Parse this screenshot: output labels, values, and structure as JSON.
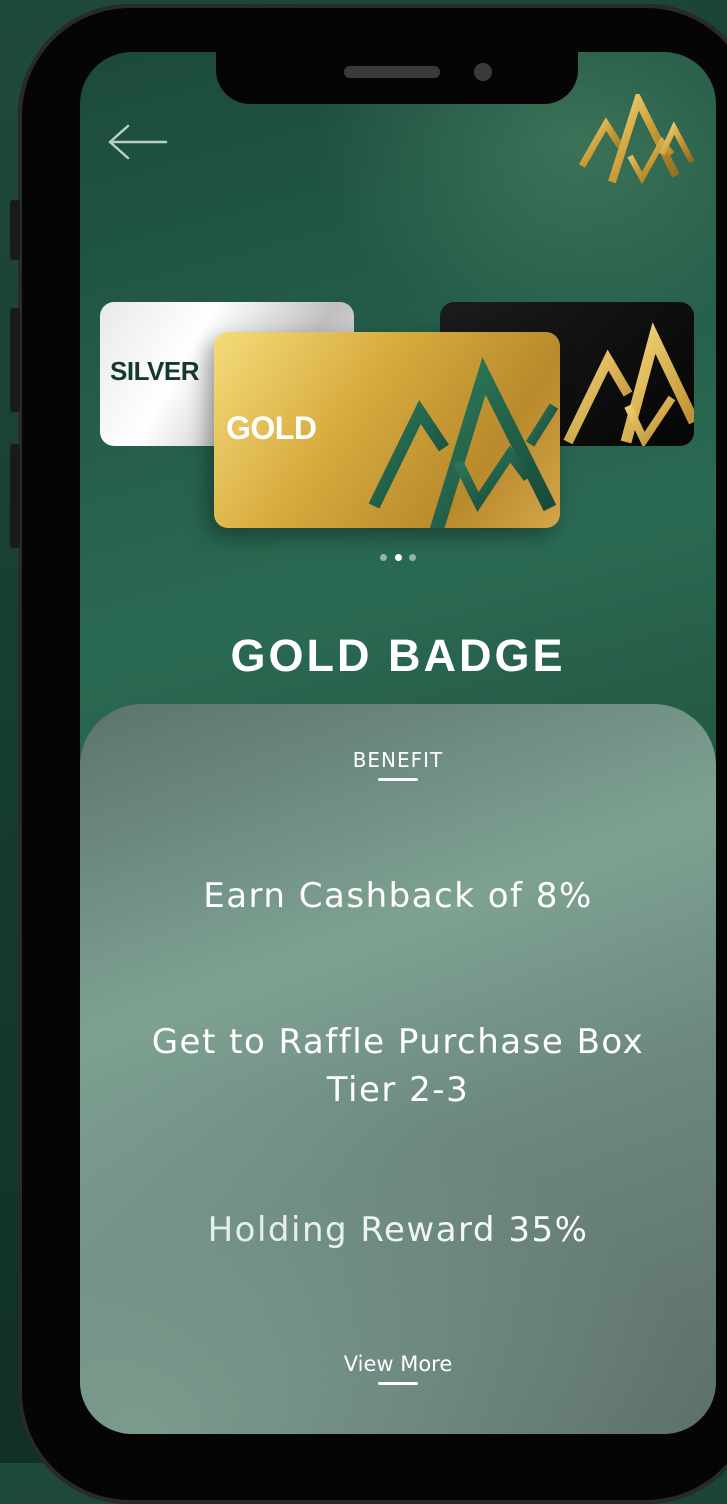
{
  "header": {
    "back_icon": "arrow-left-icon",
    "logo_icon": "mountain-peaks-logo-icon"
  },
  "carousel": {
    "cards": [
      {
        "label": "SILVER",
        "style": "silver"
      },
      {
        "label": "GOLD",
        "style": "gold"
      },
      {
        "label": "",
        "style": "black"
      }
    ],
    "active_index": 1,
    "page_count": 3
  },
  "badge": {
    "title": "GOLD BADGE"
  },
  "benefits": {
    "heading": "BENEFIT",
    "items": [
      "Earn Cashback of 8%",
      "Get to Raffle Purchase Box Tier 2-3",
      "Holding Reward 35%"
    ],
    "view_more_label": "View More"
  },
  "colors": {
    "gold": "#d7aa3e",
    "dark_green": "#1c4a3b",
    "panel_green": "#7ea292",
    "silver_text": "#153a2d"
  }
}
